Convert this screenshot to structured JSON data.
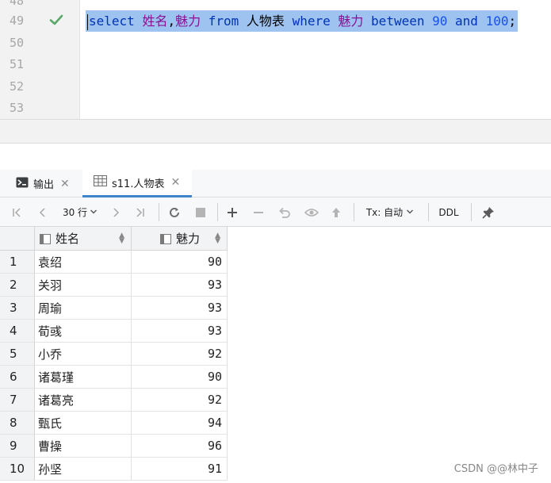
{
  "editor": {
    "lines": [
      {
        "num": "48"
      },
      {
        "num": "49"
      },
      {
        "num": "50"
      },
      {
        "num": "51"
      },
      {
        "num": "52"
      },
      {
        "num": "53"
      }
    ],
    "query": {
      "t1": "select",
      "t2": "姓名",
      "t3": ",",
      "t4": "魅力",
      "t5": "from",
      "t6": "人物表",
      "t7": "where",
      "t8": "魅力",
      "t9": "between",
      "t10": "90",
      "t11": "and",
      "t12": "100",
      "t13": ";"
    }
  },
  "tabs": {
    "output": {
      "label": "输出"
    },
    "result": {
      "label": "s11.人物表"
    }
  },
  "toolbar": {
    "rows_label": "30 行",
    "tx_label": "Tx: 自动",
    "ddl_label": "DDL"
  },
  "grid": {
    "columns": [
      {
        "label": "姓名"
      },
      {
        "label": "魅力"
      }
    ],
    "rows": [
      {
        "n": "1",
        "name": "袁绍",
        "value": "90"
      },
      {
        "n": "2",
        "name": "关羽",
        "value": "93"
      },
      {
        "n": "3",
        "name": "周瑜",
        "value": "93"
      },
      {
        "n": "4",
        "name": "荀彧",
        "value": "93"
      },
      {
        "n": "5",
        "name": "小乔",
        "value": "92"
      },
      {
        "n": "6",
        "name": "诸葛瑾",
        "value": "90"
      },
      {
        "n": "7",
        "name": "诸葛亮",
        "value": "92"
      },
      {
        "n": "8",
        "name": "甄氏",
        "value": "94"
      },
      {
        "n": "9",
        "name": "曹操",
        "value": "96"
      },
      {
        "n": "10",
        "name": "孙坚",
        "value": "91"
      }
    ]
  },
  "watermark": "CSDN @@林中子"
}
